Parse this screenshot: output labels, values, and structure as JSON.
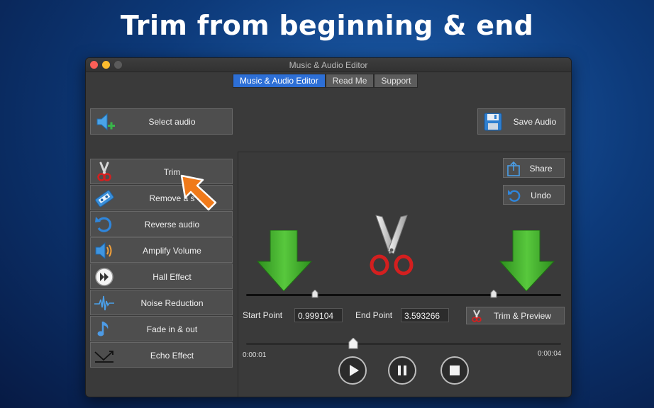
{
  "headline": "Trim from beginning & end",
  "window": {
    "title": "Music & Audio Editor",
    "tabs": [
      {
        "label": "Music & Audio Editor",
        "active": true
      },
      {
        "label": "Read Me",
        "active": false
      },
      {
        "label": "Support",
        "active": false
      }
    ]
  },
  "buttons": {
    "select_audio": "Select audio",
    "save_audio": "Save Audio",
    "share": "Share",
    "undo": "Undo",
    "trim_preview": "Trim & Preview"
  },
  "tools": [
    {
      "label": "Trim",
      "icon": "scissors-icon"
    },
    {
      "label": "Remove a s",
      "icon": "cassette-tape-icon"
    },
    {
      "label": "Reverse audio",
      "icon": "rotate-arrow-icon"
    },
    {
      "label": "Amplify Volume",
      "icon": "speaker-icon"
    },
    {
      "label": "Hall Effect",
      "icon": "fast-forward-circle-icon"
    },
    {
      "label": "Noise Reduction",
      "icon": "waveform-icon"
    },
    {
      "label": "Fade in & out",
      "icon": "music-note-icon"
    },
    {
      "label": "Echo Effect",
      "icon": "echo-arrow-icon"
    }
  ],
  "trim": {
    "start_label": "Start Point",
    "start_value": "0.999104",
    "end_label": "End Point",
    "end_value": "3.593266"
  },
  "player": {
    "current_time": "0:00:01",
    "duration": "0:00:04",
    "playhead_position": 0.34
  },
  "colors": {
    "accent_tab": "#2d6fd6",
    "arrow_green": "#3fae2c",
    "pointer_orange": "#f07a1a",
    "scissors_red": "#d41f1f"
  }
}
